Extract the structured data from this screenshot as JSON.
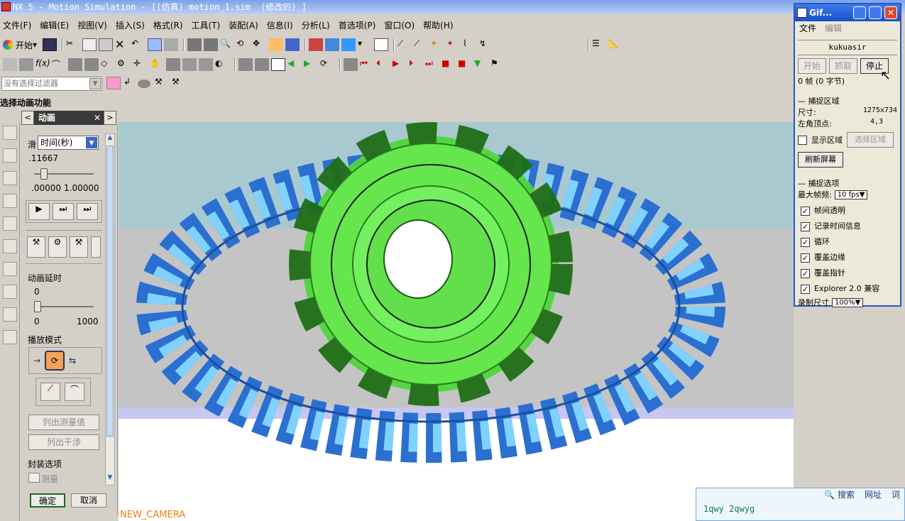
{
  "window": {
    "title": "NX 5 - Motion Simulation - [(仿真) motion_1.sim  (修改的) ]"
  },
  "menu": [
    "文件(F)",
    "编辑(E)",
    "视图(V)",
    "插入(S)",
    "格式(R)",
    "工具(T)",
    "装配(A)",
    "信息(I)",
    "分析(L)",
    "首选项(P)",
    "窗口(O)",
    "帮助(H)"
  ],
  "toolbar": {
    "start_label": "开始"
  },
  "filter": {
    "placeholder": "没有选择过滤器"
  },
  "cue": "选择动画功能",
  "anim_panel": {
    "title": "动画",
    "slider_dropdown": "时间(秒)",
    "slider_label_prefix": "滑",
    "time_value": ".11667",
    "range_min": ".00000",
    "range_max": "1.00000",
    "delay_label": "动画延时",
    "delay_value": "0",
    "delay_min": "0",
    "delay_max": "1000",
    "play_mode_label": "播放模式",
    "list_measures": "列出测量值",
    "list_interference": "列出干涉",
    "package_label": "封装选项",
    "measure_label": "测量",
    "ok": "确定",
    "cancel": "取消"
  },
  "viewport": {
    "camera_label": "NEW_CAMERA"
  },
  "gif": {
    "title": "Gif...",
    "menu_file": "文件",
    "menu_edit": "编辑",
    "user": "kukuasir",
    "btn_start": "开始",
    "btn_capture": "抓取",
    "btn_stop": "停止",
    "frame_info": "0 帧 (0 字节)",
    "capture_area_heading": "捕捉区域",
    "size_label": "尺寸:",
    "size_value": "1275x734",
    "corner_label": "左角顶点:",
    "corner_value": "4,3",
    "show_area": "显示区域",
    "select_area": "选择区域",
    "refresh": "刷新屏幕",
    "capture_options_heading": "捕捉选项",
    "max_fps_label": "最大帧频:",
    "max_fps_value": "10 fps",
    "opts": [
      "帧间透明",
      "记录时间信息",
      "循环",
      "覆盖边缘",
      "覆盖指针",
      "Explorer 2.0 兼容"
    ],
    "record_size_label": "录制尺寸",
    "record_size_value": "100%"
  },
  "im": {
    "search": "搜索",
    "addr": "网址",
    "words": "词",
    "input_text": "1qwy 2qwyg"
  },
  "colors": {
    "title_bar": "#7aa2e8",
    "viewport_bg": "#a9c9d0",
    "gear_green": "#55dd44",
    "gear_blue": "#3aa8f0"
  }
}
